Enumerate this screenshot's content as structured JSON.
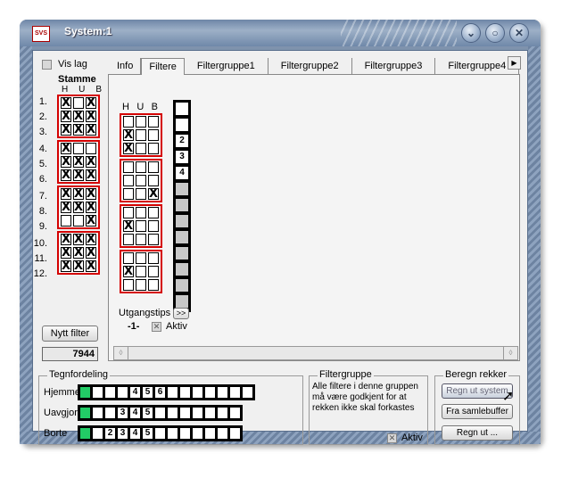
{
  "window": {
    "title": "System:1",
    "app_icon_text": "SVS"
  },
  "left": {
    "vis_lag_label": "Vis lag",
    "stamme_label": "Stamme",
    "cols": [
      "H",
      "U",
      "B"
    ],
    "rows": [
      {
        "n": "1.",
        "c": [
          "X",
          "",
          "X"
        ]
      },
      {
        "n": "2.",
        "c": [
          "X",
          "X",
          "X"
        ]
      },
      {
        "n": "3.",
        "c": [
          "X",
          "X",
          "X"
        ]
      },
      {
        "n": "4.",
        "c": [
          "X",
          "",
          ""
        ]
      },
      {
        "n": "5.",
        "c": [
          "X",
          "X",
          "X"
        ]
      },
      {
        "n": "6.",
        "c": [
          "X",
          "X",
          "X"
        ]
      },
      {
        "n": "7.",
        "c": [
          "X",
          "X",
          "X"
        ]
      },
      {
        "n": "8.",
        "c": [
          "X",
          "X",
          "X"
        ]
      },
      {
        "n": "9.",
        "c": [
          "",
          "",
          "X"
        ]
      },
      {
        "n": "10.",
        "c": [
          "X",
          "X",
          "X"
        ]
      },
      {
        "n": "11.",
        "c": [
          "X",
          "X",
          "X"
        ]
      },
      {
        "n": "12.",
        "c": [
          "X",
          "X",
          "X"
        ]
      }
    ],
    "nytt_filter_label": "Nytt filter",
    "count_value": "7944"
  },
  "tabs": [
    "Info",
    "Filtere",
    "Filtergruppe1",
    "Filtergruppe2",
    "Filtergruppe3",
    "Filtergruppe4"
  ],
  "filter": {
    "cols": [
      "H",
      "U",
      "B"
    ],
    "rows": [
      [
        "",
        "",
        ""
      ],
      [
        "X",
        "",
        ""
      ],
      [
        "X",
        "",
        ""
      ],
      [
        "",
        "",
        ""
      ],
      [
        "",
        "",
        ""
      ],
      [
        "",
        "",
        "X"
      ],
      [
        "",
        "",
        ""
      ],
      [
        "X",
        "",
        ""
      ],
      [
        "",
        "",
        ""
      ],
      [
        "",
        "",
        ""
      ],
      [
        "X",
        "",
        ""
      ],
      [
        "",
        "",
        ""
      ]
    ],
    "numbers": [
      "",
      "",
      "2",
      "3",
      "4",
      "",
      "",
      "",
      "",
      "",
      "",
      "",
      ""
    ],
    "utgangstips_label": "Utgangstips",
    "utgangstips_btn": ">>",
    "tips_value": "-1-",
    "aktiv_label": "Aktiv"
  },
  "tegnfordeling": {
    "legend": "Tegnfordeling",
    "rows": [
      {
        "label": "Hjemme",
        "boxes": [
          "",
          "",
          "",
          "",
          "4",
          "5",
          "6",
          "",
          "",
          "",
          "",
          "",
          "",
          ""
        ]
      },
      {
        "label": "Uavgjort",
        "boxes": [
          "",
          "",
          "",
          "3",
          "4",
          "5",
          "",
          "",
          "",
          "",
          "",
          "",
          ""
        ]
      },
      {
        "label": "Borte",
        "boxes": [
          "",
          "",
          "2",
          "3",
          "4",
          "5",
          "",
          "",
          "",
          "",
          "",
          "",
          ""
        ]
      }
    ]
  },
  "filtergruppe": {
    "legend": "Filtergruppe",
    "text": "Alle filtere i denne gruppen må være godkjent for at rekken ikke skal forkastes",
    "aktiv_label": "Aktiv"
  },
  "beregn": {
    "legend": "Beregn rekker",
    "btn1": "Regn ut system",
    "btn2": "Fra samlebuffer",
    "btn3": "Regn ut ..."
  },
  "colors": {
    "group_border": "#d40000",
    "green": "#22cc66"
  }
}
